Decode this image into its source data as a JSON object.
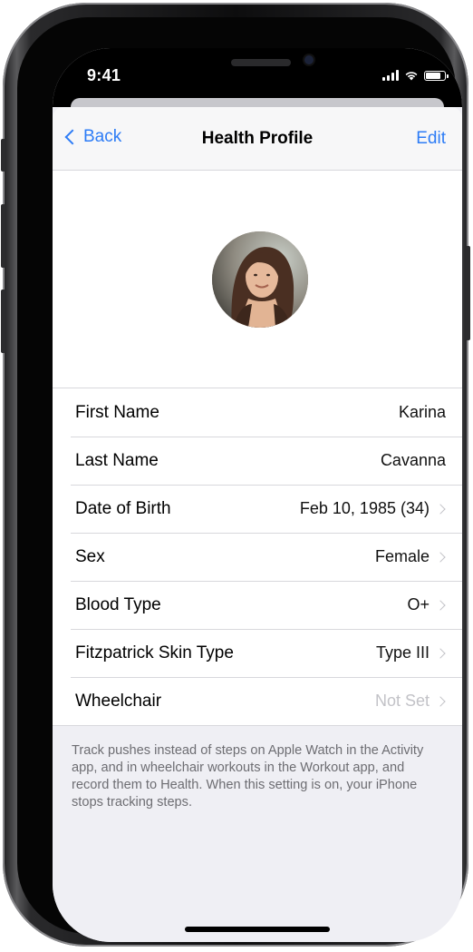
{
  "status_bar": {
    "time": "9:41",
    "signal_icon": "cellular-signal-icon",
    "wifi_icon": "wifi-icon",
    "battery_icon": "battery-icon",
    "battery_level": 0.85
  },
  "nav": {
    "back_label": "Back",
    "title": "Health Profile",
    "edit_label": "Edit",
    "back_icon": "chevron-left-icon"
  },
  "profile": {
    "avatar_icon": "profile-photo"
  },
  "rows": [
    {
      "label": "First Name",
      "value": "Karina",
      "chevron": false,
      "muted": false
    },
    {
      "label": "Last Name",
      "value": "Cavanna",
      "chevron": false,
      "muted": false
    },
    {
      "label": "Date of Birth",
      "value": "Feb 10, 1985 (34)",
      "chevron": true,
      "muted": false
    },
    {
      "label": "Sex",
      "value": "Female",
      "chevron": true,
      "muted": false
    },
    {
      "label": "Blood Type",
      "value": "O+",
      "chevron": true,
      "muted": false
    },
    {
      "label": "Fitzpatrick Skin Type",
      "value": "Type III",
      "chevron": true,
      "muted": false
    },
    {
      "label": "Wheelchair",
      "value": "Not Set",
      "chevron": true,
      "muted": true
    }
  ],
  "footer_note": "Track pushes instead of steps on Apple Watch in the Activity app, and in wheelchair workouts in the Workout app, and record them to Health. When this setting is on, your iPhone stops tracking steps.",
  "colors": {
    "accent": "#2d7cf6",
    "background": "#efeff4",
    "secondary_text": "#6d6d72"
  }
}
